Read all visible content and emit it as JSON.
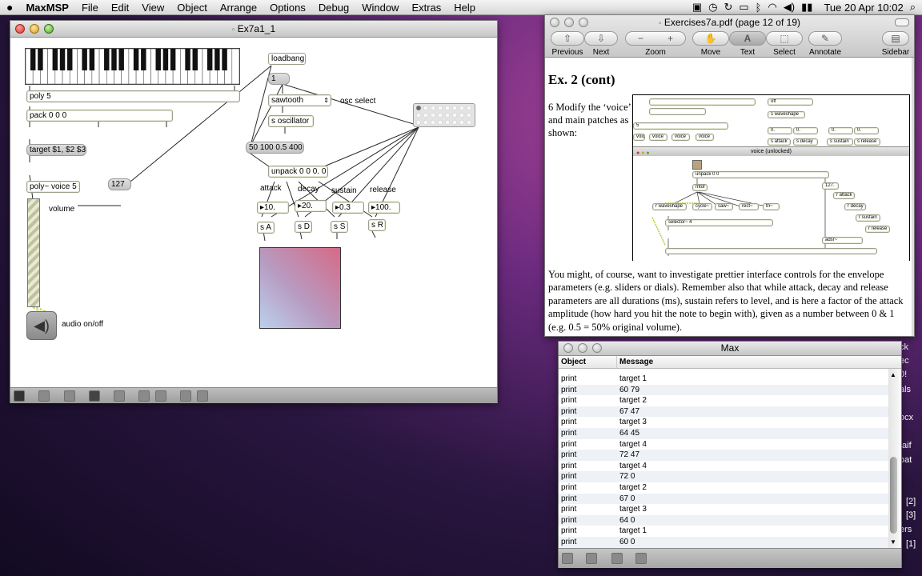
{
  "menubar": {
    "app": "MaxMSP",
    "items": [
      "File",
      "Edit",
      "View",
      "Object",
      "Arrange",
      "Options",
      "Debug",
      "Window",
      "Extras",
      "Help"
    ],
    "clock": "Tue 20 Apr  10:02"
  },
  "patcher": {
    "title": "Ex7a1_1",
    "objects": {
      "loadbang": "loadbang",
      "one": "1",
      "poly": "poly 5",
      "pack": "pack 0 0 0",
      "sawtooth": "sawtooth",
      "osc_select": "osc select",
      "s_oscillator": "s oscillator",
      "target": "target $1, $2 $3",
      "env_msg": "50 100 0.5 400",
      "unpack": "unpack 0 0 0. 0",
      "val127": "127",
      "polyvoice": "poly~ voice 5",
      "volume": "volume",
      "attack": "attack",
      "decay": "decay",
      "sustain": "sustain",
      "release": "release",
      "num_a": "10.",
      "num_d": "20.",
      "num_s": "0.3",
      "num_r": "100.",
      "s_a": "s A",
      "s_d": "s D",
      "s_s": "s S",
      "s_r": "s R",
      "audio": "audio on/off"
    }
  },
  "pdf": {
    "title": "Exercises7a.pdf (page 12 of 19)",
    "toolbar": [
      "Previous",
      "Next",
      "Zoom",
      "Move",
      "Text",
      "Select",
      "Annotate",
      "Sidebar"
    ],
    "heading": "Ex. 2 (cont)",
    "step": "6 Modify the ‘voice’ and main patches as shown:",
    "body": "You might, of course, want to investigate prettier interface controls for the envelope parameters (e.g. sliders or dials). Remember also that while attack, decay and release parameters are all durations (ms), sustain refers to level, and is here a factor of the attack amplitude (how hard you hit the note to begin with), given as a number between 0 & 1 (e.g. 0.5 = 50% original volume).",
    "figure": {
      "top_objs": [
        "off",
        "s waveshape",
        "0.",
        "0.",
        "0.",
        "0.",
        "s attack",
        "s decay",
        "s sustain",
        "s release",
        "voice",
        "voice",
        "voice",
        "5"
      ],
      "sub_title": "voice (unlocked)",
      "sub_objs": [
        "unpack 0 0",
        "mtof",
        "127.",
        "r attack",
        "r decay",
        "r sustain",
        "r release",
        "r waveshape",
        "cycle~",
        "saw~",
        "rect~",
        "tri~",
        "selector~ 4",
        "adsr~"
      ]
    }
  },
  "console": {
    "title": "Max",
    "headers": [
      "Object",
      "Message"
    ],
    "rows": [
      [
        "print",
        "target 1"
      ],
      [
        "print",
        "60 79"
      ],
      [
        "print",
        "target 2"
      ],
      [
        "print",
        "67 47"
      ],
      [
        "print",
        "target 3"
      ],
      [
        "print",
        "64 45"
      ],
      [
        "print",
        "target 4"
      ],
      [
        "print",
        "72 47"
      ],
      [
        "print",
        "target 4"
      ],
      [
        "print",
        "72 0"
      ],
      [
        "print",
        "target 2"
      ],
      [
        "print",
        "67 0"
      ],
      [
        "print",
        "target 3"
      ],
      [
        "print",
        "64 0"
      ],
      [
        "print",
        "target 1"
      ],
      [
        "print",
        "60 0"
      ]
    ]
  },
  "desktop_labels": [
    "ck",
    "ec",
    "0!",
    "als",
    "ocx",
    ".aif",
    "oat",
    "[2]",
    "[3]",
    "ers",
    "[1]"
  ]
}
